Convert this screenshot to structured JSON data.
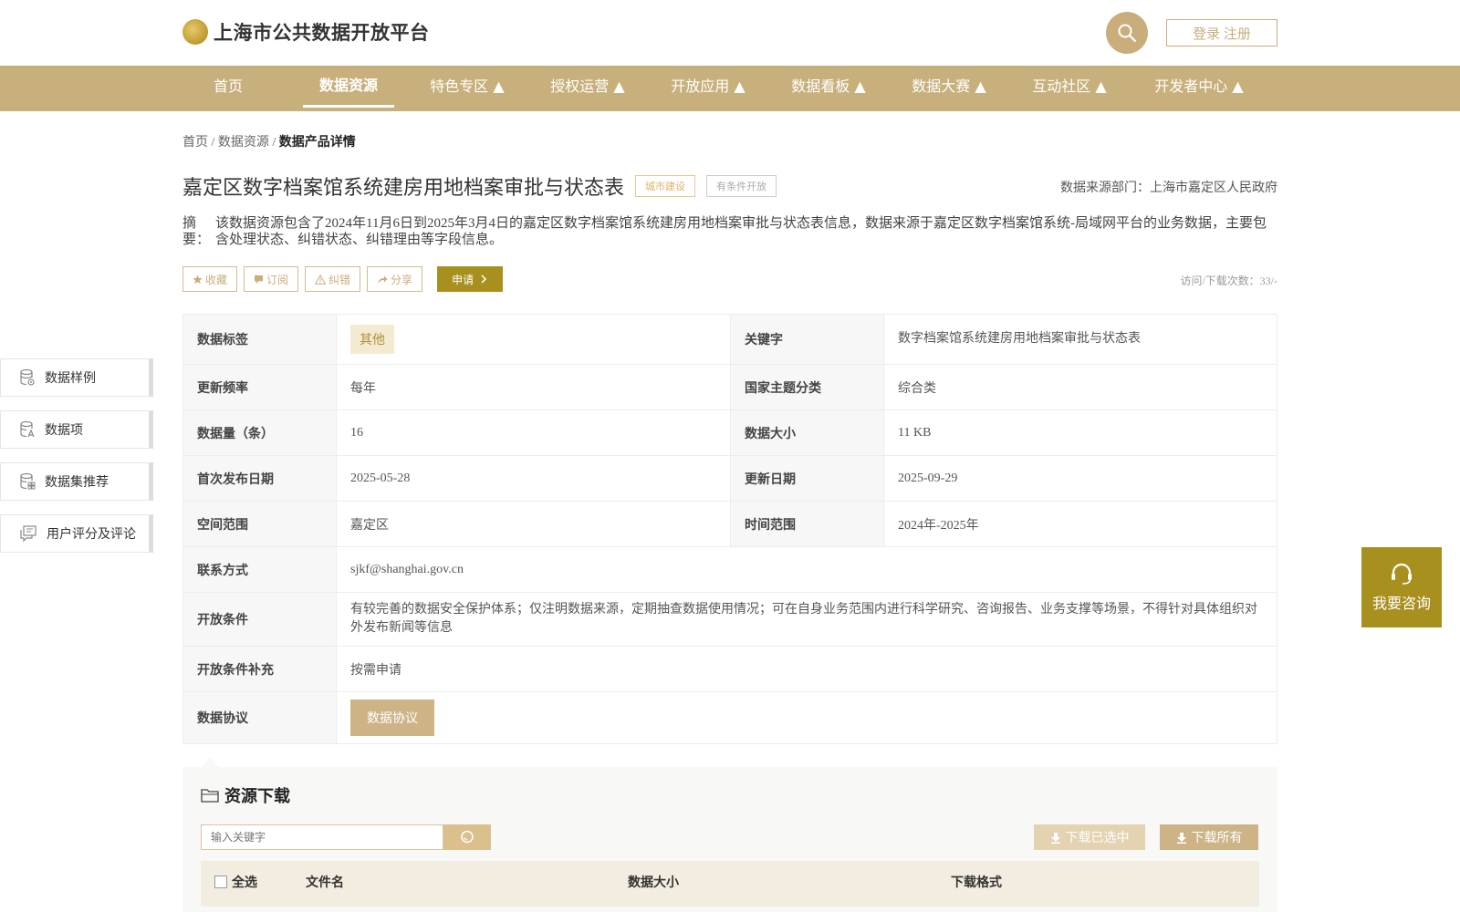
{
  "header": {
    "site_title": "上海市公共数据开放平台",
    "login_label": "登录 注册"
  },
  "nav": {
    "items": [
      {
        "label": "首页"
      },
      {
        "label": "数据资源"
      },
      {
        "label": "特色专区 ▲"
      },
      {
        "label": "授权运营 ▲"
      },
      {
        "label": "开放应用 ▲"
      },
      {
        "label": "数据看板 ▲"
      },
      {
        "label": "数据大赛 ▲"
      },
      {
        "label": "互动社区 ▲"
      },
      {
        "label": "开发者中心 ▲"
      }
    ],
    "active_index": 1
  },
  "breadcrumb": {
    "home": "首页",
    "sep1": " / ",
    "resources": "数据资源",
    "sep2": " / ",
    "current": "数据产品详情"
  },
  "product": {
    "title": "嘉定区数字档案馆系统建房用地档案审批与状态表",
    "tag_category": "城市建设",
    "tag_open": "有条件开放",
    "source_department": "数据来源部门：上海市嘉定区人民政府",
    "abstract_label": "摘要：",
    "abstract_text": "该数据资源包含了2024年11月6日到2025年3月4日的嘉定区数字档案馆系统建房用地档案审批与状态表信息，数据来源于嘉定区数字档案馆系统-局域网平台的业务数据，主要包含处理状态、纠错状态、纠错理由等字段信息。",
    "visits": "访问/下载次数：33/-"
  },
  "actions": {
    "favorite": "收藏",
    "subscribe": "订阅",
    "correct": "纠错",
    "share": "分享",
    "apply": "申请"
  },
  "side_menu": {
    "items": [
      {
        "label": "数据样例"
      },
      {
        "label": "数据项"
      },
      {
        "label": "数据集推荐"
      },
      {
        "label": "用户评分及评论"
      }
    ]
  },
  "info": {
    "tags_label": "数据标签",
    "tags_value": "其他",
    "keyword_label": "关键字",
    "keyword_value": "数字档案馆系统建房用地档案审批与状态表",
    "freq_label": "更新频率",
    "freq_value": "每年",
    "theme_label": "国家主题分类",
    "theme_value": "综合类",
    "count_label": "数据量（条）",
    "count_value": "16",
    "size_label": "数据大小",
    "size_value": "11 KB",
    "first_pub_label": "首次发布日期",
    "first_pub_value": "2025-05-28",
    "update_label": "更新日期",
    "update_value": "2025-09-29",
    "space_label": "空间范围",
    "space_value": "嘉定区",
    "time_label": "时间范围",
    "time_value": "2024年-2025年",
    "contact_label": "联系方式",
    "contact_value": "sjkf@shanghai.gov.cn",
    "cond_label": "开放条件",
    "cond_value": "有较完善的数据安全保护体系；仅注明数据来源，定期抽查数据使用情况；可在自身业务范围内进行科学研究、咨询报告、业务支撑等场景，不得针对具体组织对外发布新闻等信息",
    "cond_extra_label": "开放条件补充",
    "cond_extra_value": "按需申请",
    "protocol_label": "数据协议",
    "protocol_button": "数据协议"
  },
  "consult": {
    "label": "我要咨询"
  },
  "download": {
    "title": "资源下载",
    "search_placeholder": "输入关键字",
    "download_selected": "下载已选中",
    "download_all": "下载所有",
    "columns": {
      "select_all": "全选",
      "file_name": "文件名",
      "data_size": "数据大小",
      "format": "下载格式"
    }
  },
  "colors": {
    "brand_gold": "#c8b07c",
    "apply_olive": "#a8901e"
  }
}
